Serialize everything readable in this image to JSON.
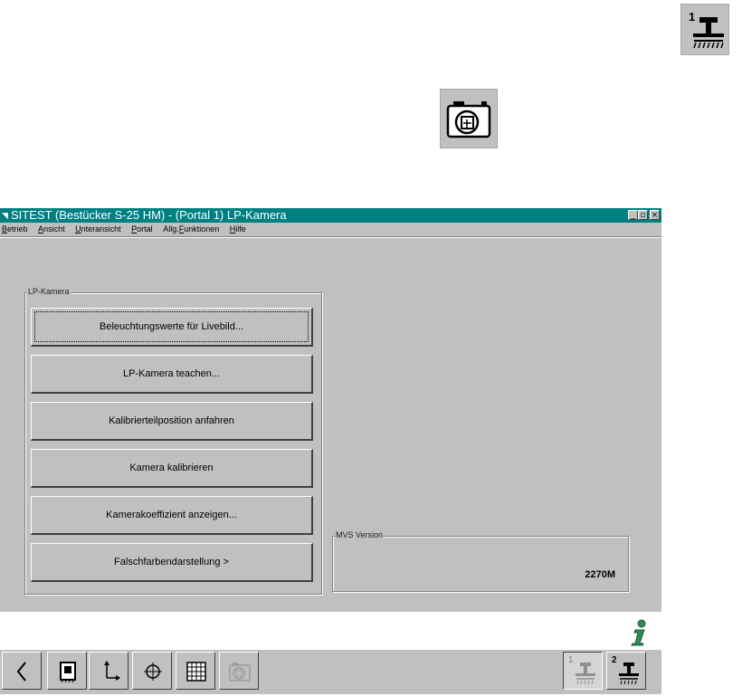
{
  "window": {
    "title": "SITEST (Bestücker S-25 HM) - (Portal 1) LP-Kamera",
    "controls": {
      "minimize": "_",
      "maximize": "▫",
      "close": "×"
    }
  },
  "menu": {
    "items": [
      {
        "label": "Betrieb",
        "mnemonic": "B",
        "rest": "etrieb"
      },
      {
        "label": "Ansicht",
        "mnemonic": "A",
        "rest": "nsicht"
      },
      {
        "label": "Unteransicht",
        "mnemonic": "U",
        "rest": "nteransicht"
      },
      {
        "label": "Portal",
        "mnemonic": "P",
        "rest": "ortal"
      },
      {
        "label": "Allg.Funktionen",
        "pre": "Allg.",
        "mnemonic": "F",
        "rest": "unktionen"
      },
      {
        "label": "Hilfe",
        "mnemonic": "H",
        "rest": "ilfe"
      }
    ]
  },
  "lp_camera_group": {
    "label": "LP-Kamera",
    "buttons": [
      "Beleuchtungswerte für Livebild...",
      "LP-Kamera teachen...",
      "Kalibrierteilposition anfahren",
      "Kamera kalibrieren",
      "Kamerakoeffizient anzeigen...",
      "Falschfarbendarstellung >"
    ]
  },
  "mvs_group": {
    "label": "MVS Version",
    "value": "2270M"
  },
  "top_icons": {
    "portal_number": "1",
    "portal_icon": "placement-head-icon",
    "camera_icon": "camera-icon"
  },
  "toolbar": {
    "buttons": [
      {
        "name": "back-arrow-icon"
      },
      {
        "name": "machine-view-icon"
      },
      {
        "name": "axes-icon"
      },
      {
        "name": "crosshair-icon"
      },
      {
        "name": "grid-icon"
      },
      {
        "name": "camera-disabled-icon"
      }
    ],
    "portal_buttons": [
      {
        "number": "1",
        "name": "portal-1-icon"
      },
      {
        "number": "2",
        "name": "portal-2-icon"
      }
    ]
  },
  "colors": {
    "titlebar": "#008080",
    "face": "#c0c0c0",
    "info_icon": "#2e8b57"
  }
}
